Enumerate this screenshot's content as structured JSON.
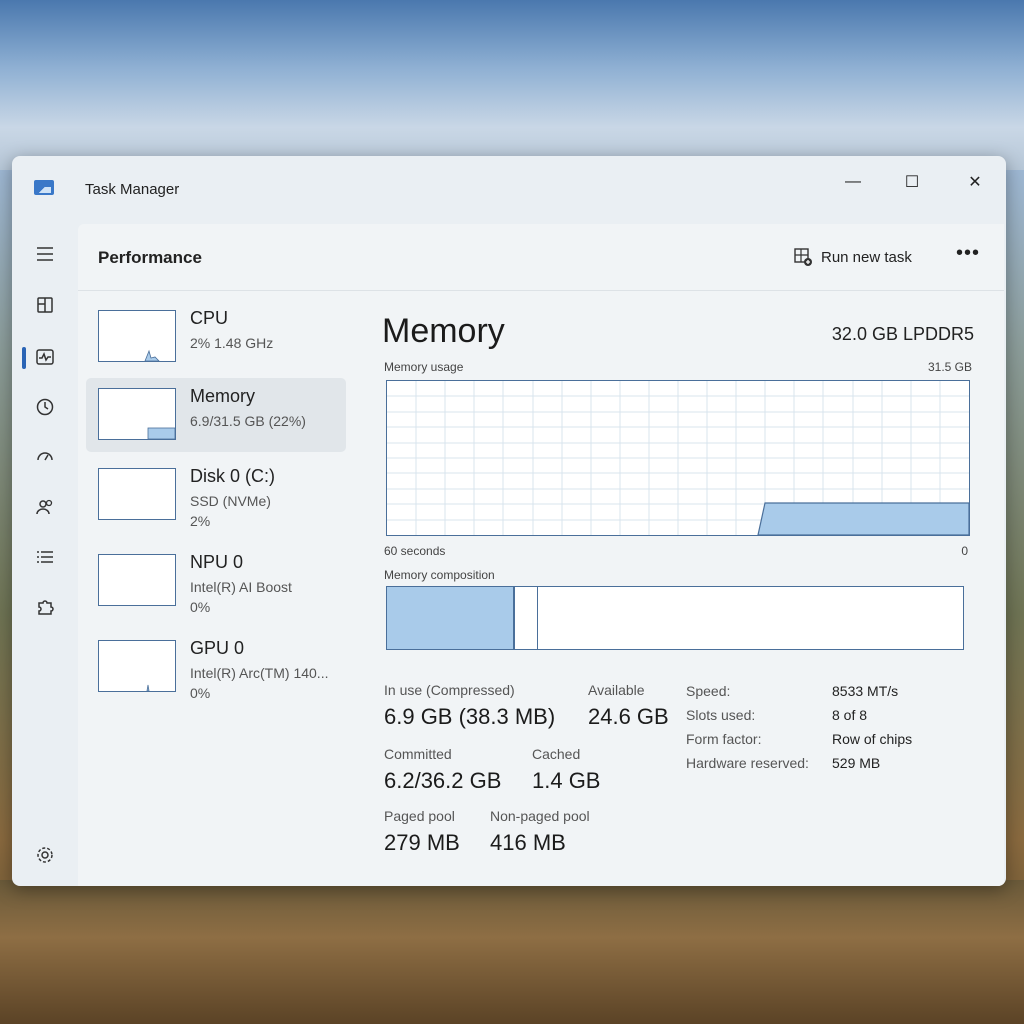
{
  "window": {
    "title": "Task Manager"
  },
  "header": {
    "title": "Performance",
    "run_task_label": "Run new task",
    "more_label": "•••"
  },
  "window_controls": {
    "minimize": "—",
    "maximize": "☐",
    "close": "✕"
  },
  "devices": [
    {
      "name": "CPU",
      "sub": "2%  1.48 GHz",
      "sub2": ""
    },
    {
      "name": "Memory",
      "sub": "6.9/31.5 GB (22%)",
      "sub2": ""
    },
    {
      "name": "Disk 0 (C:)",
      "sub": "SSD (NVMe)",
      "sub2": "2%"
    },
    {
      "name": "NPU 0",
      "sub": "Intel(R) AI Boost",
      "sub2": "0%"
    },
    {
      "name": "GPU 0",
      "sub": "Intel(R) Arc(TM) 140...",
      "sub2": "0%"
    }
  ],
  "main": {
    "title": "Memory",
    "spec": "32.0 GB LPDDR5",
    "usage_label": "Memory usage",
    "usage_max": "31.5 GB",
    "time_left": "60 seconds",
    "time_right": "0",
    "composition_label": "Memory composition"
  },
  "stats": {
    "in_use_label": "In use (Compressed)",
    "in_use_value": "6.9 GB (38.3 MB)",
    "available_label": "Available",
    "available_value": "24.6 GB",
    "committed_label": "Committed",
    "committed_value": "6.2/36.2 GB",
    "cached_label": "Cached",
    "cached_value": "1.4 GB",
    "paged_label": "Paged pool",
    "paged_value": "279 MB",
    "nonpaged_label": "Non-paged pool",
    "nonpaged_value": "416 MB"
  },
  "details": {
    "speed_label": "Speed:",
    "speed_value": "8533 MT/s",
    "slots_label": "Slots used:",
    "slots_value": "8 of 8",
    "form_label": "Form factor:",
    "form_value": "Row of chips",
    "reserved_label": "Hardware reserved:",
    "reserved_value": "529 MB"
  },
  "colors": {
    "accent": "#2a64b5",
    "graph_fill": "#a9cbea",
    "graph_line": "#4a6f9a"
  }
}
